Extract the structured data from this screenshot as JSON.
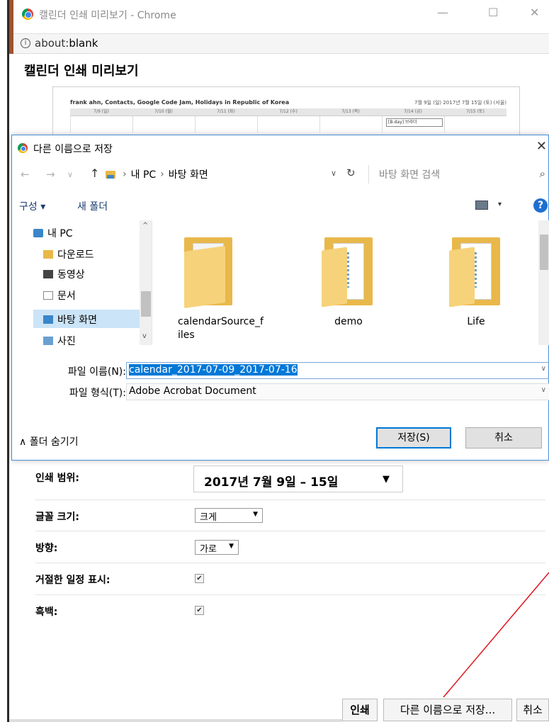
{
  "window": {
    "title": "캘린더 인쇄 미리보기 - Chrome",
    "minimize_glyph": "—",
    "maximize_glyph": "☐",
    "close_glyph": "✕"
  },
  "address_bar": {
    "scheme": "about:",
    "host": "blank"
  },
  "page": {
    "heading": "캘린더 인쇄 미리보기"
  },
  "preview": {
    "calendar_names": "frank ahn, Contacts, Google Code Jam, Holidays in Republic of Korea",
    "range_text": "7월 9일 (일) 2017년 7월 15일 (토) (서울)",
    "days": [
      "7/9 (일)",
      "7/10 (월)",
      "7/11 (화)",
      "7/12 (수)",
      "7/13 (목)",
      "7/14 (금)",
      "7/15 (토)"
    ],
    "event": "[B-day] 브라더"
  },
  "save_dialog": {
    "title": "다른 이름으로 저장",
    "nav": {
      "back": "←",
      "forward": "→",
      "recent": "∨",
      "up": "↑",
      "path": [
        "내 PC",
        "바탕 화면"
      ],
      "path_sep": "›",
      "dropdown": "∨",
      "refresh": "↻",
      "search_placeholder": "바탕 화면 검색",
      "search_glyph": "⌕"
    },
    "toolbar": {
      "organize": "구성 ▾",
      "new_folder": "새 폴더",
      "view_dropdown": "▾",
      "help": "?"
    },
    "nav_pane": {
      "items": [
        "내 PC",
        "다운로드",
        "동영상",
        "문서",
        "바탕 화면",
        "사진"
      ],
      "selected": "바탕 화면",
      "scroll_up": "^",
      "scroll_down": "v"
    },
    "files": [
      {
        "name": "calendarSource_f",
        "name2": "iles"
      },
      {
        "name": "demo"
      },
      {
        "name": "Life"
      }
    ],
    "filename_label": "파일 이름(N):",
    "filename_value": "calendar_2017-07-09_2017-07-16",
    "filetype_label": "파일 형식(T):",
    "filetype_value": "Adobe Acrobat Document",
    "field_dropdown": "∨",
    "hide_folders": "∧ 폴더 숨기기",
    "save_button": "저장(S)",
    "cancel_button": "취소",
    "close": "✕"
  },
  "print_settings": {
    "range_label": "인쇄 범위:",
    "range_value": "2017년 7월 9일 – 15일",
    "range_arrow": "▼",
    "font_size_label": "글꼴 크기:",
    "font_size_value": "크게",
    "orientation_label": "방향:",
    "orientation_value": "가로",
    "small_arrow": "▼",
    "show_declined_label": "거절한 일정 표시:",
    "bw_label": "흑백:",
    "checkmark": "✔"
  },
  "print_buttons": {
    "print": "인쇄",
    "save_as": "다른 이름으로 저장...",
    "cancel": "취소"
  },
  "colors": {
    "accent": "#0078d7",
    "selection": "#cce4f7",
    "folder": "#e9b84a",
    "annotation": "#e0141e"
  }
}
